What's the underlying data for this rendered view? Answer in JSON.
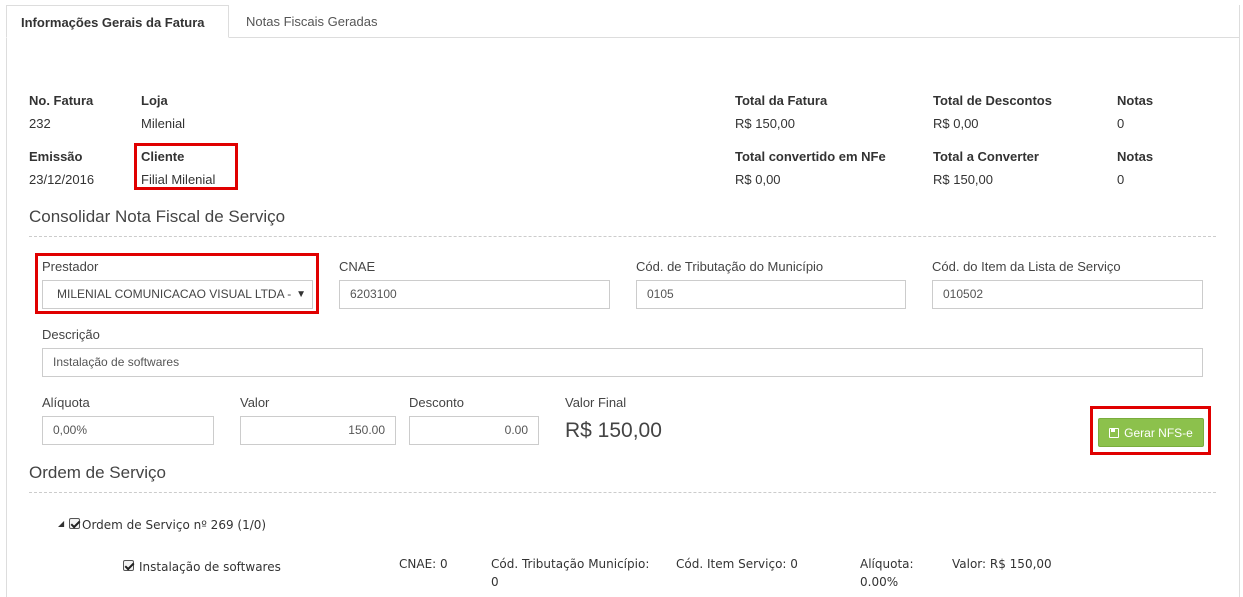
{
  "tabs": {
    "general": "Informações Gerais da Fatura",
    "invoices": "Notas Fiscais Geradas"
  },
  "summary": {
    "no_fatura_label": "No. Fatura",
    "no_fatura": "232",
    "loja_label": "Loja",
    "loja": "Milenial",
    "emissao_label": "Emissão",
    "emissao": "23/12/2016",
    "cliente_label": "Cliente",
    "cliente": "Filial Milenial",
    "total_fatura_label": "Total da Fatura",
    "total_fatura": "R$ 150,00",
    "total_descontos_label": "Total de Descontos",
    "total_descontos": "R$ 0,00",
    "notas1_label": "Notas",
    "notas1": "0",
    "total_convertido_label": "Total convertido em NFe",
    "total_convertido": "R$ 0,00",
    "total_converter_label": "Total a Converter",
    "total_converter": "R$ 150,00",
    "notas2_label": "Notas",
    "notas2": "0"
  },
  "consolidar": {
    "title": "Consolidar Nota Fiscal de Serviço",
    "prestador_label": "Prestador",
    "prestador_value": "MILENIAL COMUNICACAO VISUAL LTDA -",
    "cnae_label": "CNAE",
    "cnae_value": "6203100",
    "cod_trib_label": "Cód. de Tributação do Município",
    "cod_trib_value": "0105",
    "cod_item_label": "Cód. do Item da Lista de Serviço",
    "cod_item_value": "010502",
    "descricao_label": "Descrição",
    "descricao_value": "Instalação de softwares",
    "aliquota_label": "Alíquota",
    "aliquota_value": "0,00%",
    "valor_label": "Valor",
    "valor_value": "150.00",
    "desconto_label": "Desconto",
    "desconto_value": "0.00",
    "valor_final_label": "Valor Final",
    "valor_final": "R$ 150,00",
    "gerar_button": "Gerar NFS-e"
  },
  "ordem": {
    "title": "Ordem de Serviço",
    "node_label": "Ordem de Serviço nº 269 (1/0)",
    "item_label": "Instalação de softwares",
    "cnae": "CNAE: 0",
    "cod_trib_line1": "Cód. Tributação Município:",
    "cod_trib_line2": "0",
    "cod_item": "Cód. Item Serviço: 0",
    "aliquota_line1": "Alíquota:",
    "aliquota_line2": "0.00%",
    "valor": "Valor: R$ 150,00"
  },
  "colors": {
    "highlight": "#e00000",
    "button_green": "#8cc14c"
  }
}
